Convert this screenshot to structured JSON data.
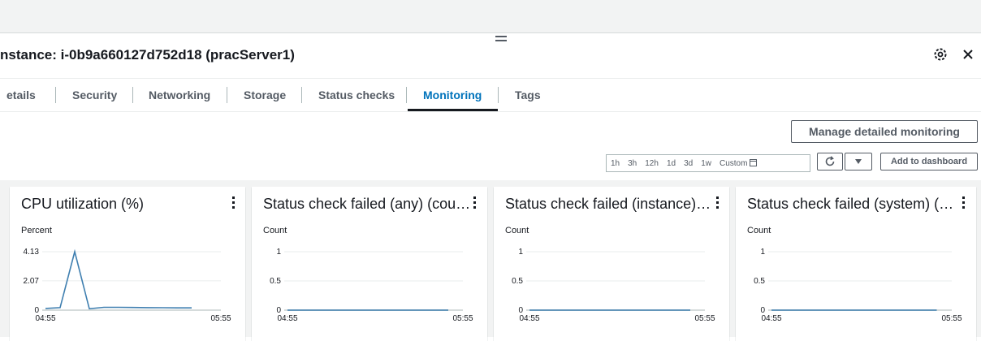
{
  "header": {
    "title": "nstance: i-0b9a660127d752d18 (pracServer1)"
  },
  "tabs": [
    {
      "label": "etails",
      "active": false
    },
    {
      "label": "Security",
      "active": false
    },
    {
      "label": "Networking",
      "active": false
    },
    {
      "label": "Storage",
      "active": false
    },
    {
      "label": "Status checks",
      "active": false
    },
    {
      "label": "Monitoring",
      "active": true
    },
    {
      "label": "Tags",
      "active": false
    }
  ],
  "toolbar": {
    "manage_label": "Manage detailed monitoring",
    "ranges": [
      "1h",
      "3h",
      "12h",
      "1d",
      "3d",
      "1w"
    ],
    "custom_label": "Custom",
    "add_dashboard_label": "Add to dashboard"
  },
  "colors": {
    "line": "#3f7fb0",
    "accent": "#0073bb"
  },
  "icons": [
    "settings-icon",
    "close-icon",
    "refresh-icon",
    "caret-down-icon",
    "calendar-icon",
    "kebab-menu-icon"
  ],
  "chart_data": [
    {
      "type": "line",
      "title": "CPU utilization (%)",
      "ylabel": "Percent",
      "yticks": [
        0,
        2.07,
        4.13
      ],
      "ytick_labels": [
        "0",
        "2.07",
        "4.13"
      ],
      "ylim": [
        0,
        4.13
      ],
      "xtick_labels": [
        "04:55",
        "05:55"
      ],
      "x": [
        "04:55",
        "05:00",
        "05:05",
        "05:10",
        "05:15",
        "05:20",
        "05:25",
        "05:30",
        "05:35",
        "05:40",
        "05:45",
        "05:50",
        "05:55"
      ],
      "series": [
        {
          "values": [
            0.12,
            0.18,
            4.13,
            0.1,
            0.2,
            0.2,
            0.19,
            0.18,
            0.17,
            0.16,
            0.16,
            null,
            null
          ]
        }
      ]
    },
    {
      "type": "line",
      "title": "Status check failed (any) (cou…",
      "ylabel": "Count",
      "yticks": [
        0,
        0.5,
        1
      ],
      "ytick_labels": [
        "0",
        "0.5",
        "1"
      ],
      "ylim": [
        0,
        1
      ],
      "xtick_labels": [
        "04:55",
        "05:55"
      ],
      "x": [
        "04:55",
        "05:00",
        "05:05",
        "05:10",
        "05:15",
        "05:20",
        "05:25",
        "05:30",
        "05:35",
        "05:40",
        "05:45",
        "05:50",
        "05:55"
      ],
      "series": [
        {
          "values": [
            0,
            0,
            0,
            0,
            0,
            0,
            0,
            0,
            0,
            0,
            0,
            0,
            null
          ]
        }
      ]
    },
    {
      "type": "line",
      "title": "Status check failed (instance)…",
      "ylabel": "Count",
      "yticks": [
        0,
        0.5,
        1
      ],
      "ytick_labels": [
        "0",
        "0.5",
        "1"
      ],
      "ylim": [
        0,
        1
      ],
      "xtick_labels": [
        "04:55",
        "05:55"
      ],
      "x": [
        "04:55",
        "05:00",
        "05:05",
        "05:10",
        "05:15",
        "05:20",
        "05:25",
        "05:30",
        "05:35",
        "05:40",
        "05:45",
        "05:50",
        "05:55"
      ],
      "series": [
        {
          "values": [
            0,
            0,
            0,
            0,
            0,
            0,
            0,
            0,
            0,
            0,
            0,
            0,
            null
          ]
        }
      ]
    },
    {
      "type": "line",
      "title": "Status check failed (system) (…",
      "ylabel": "Count",
      "yticks": [
        0,
        0.5,
        1
      ],
      "ytick_labels": [
        "0",
        "0.5",
        "1"
      ],
      "ylim": [
        0,
        1
      ],
      "xtick_labels": [
        "04:55",
        "05:55"
      ],
      "x": [
        "04:55",
        "05:00",
        "05:05",
        "05:10",
        "05:15",
        "05:20",
        "05:25",
        "05:30",
        "05:35",
        "05:40",
        "05:45",
        "05:50",
        "05:55"
      ],
      "series": [
        {
          "values": [
            0,
            0,
            0,
            0,
            0,
            0,
            0,
            0,
            0,
            0,
            0,
            0,
            null
          ]
        }
      ]
    }
  ]
}
